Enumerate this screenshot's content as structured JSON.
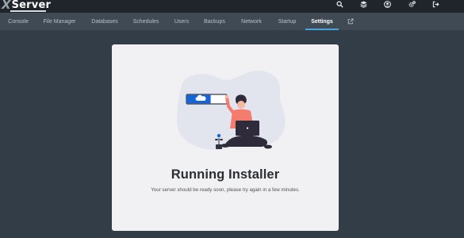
{
  "brand": {
    "logo_x": "X",
    "logo_name": "Server"
  },
  "top_icons": [
    "search-icon",
    "layers-icon",
    "account-icon",
    "cogs-icon",
    "sign-out-icon"
  ],
  "tabs": [
    {
      "label": "Console",
      "active": false
    },
    {
      "label": "File Manager",
      "active": false
    },
    {
      "label": "Databases",
      "active": false
    },
    {
      "label": "Schedules",
      "active": false
    },
    {
      "label": "Users",
      "active": false
    },
    {
      "label": "Backups",
      "active": false
    },
    {
      "label": "Network",
      "active": false
    },
    {
      "label": "Startup",
      "active": false
    },
    {
      "label": "Settings",
      "active": true
    }
  ],
  "external_link_icon": "external-link-icon",
  "installer": {
    "title": "Running Installer",
    "message": "Your server should be ready soon, please try again in a few minutes."
  },
  "colors": {
    "topbar": "#1f252b",
    "tabbar": "#3f4a55",
    "page_bg": "#333d47",
    "active_tab_underline": "#4aa3df",
    "card_bg": "#f1f1f3",
    "illustration_accent": "#1565d8",
    "illustration_person": "#f47c6e"
  }
}
